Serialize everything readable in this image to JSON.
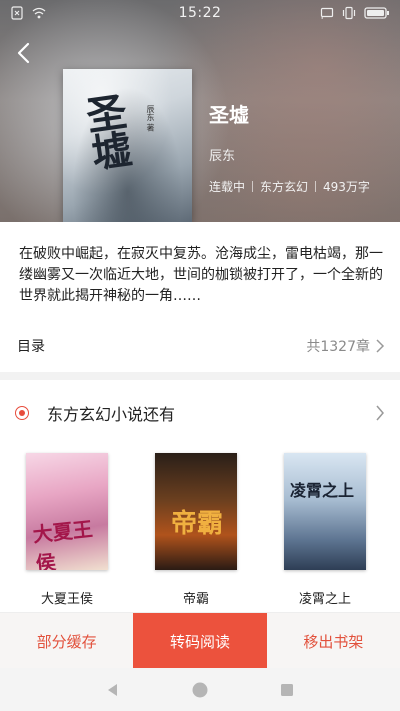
{
  "status_bar": {
    "time": "15:22",
    "left_icons": [
      "sim-icon",
      "wifi-icon"
    ],
    "right_icons": [
      "cast-icon",
      "vibrate-icon",
      "battery-icon"
    ]
  },
  "book": {
    "title": "圣墟",
    "author": "辰东",
    "status": "连载中",
    "genre": "东方玄幻",
    "word_count": "493万字",
    "cover_title_text": "圣墟",
    "cover_author_text": "辰东 著",
    "description": "在破败中崛起，在寂灭中复苏。沧海成尘，雷电枯竭，那一缕幽雾又一次临近大地，世间的枷锁被打开了，一个全新的世界就此揭开神秘的一角……"
  },
  "toc": {
    "label": "目录",
    "count": "共1327章"
  },
  "recommend": {
    "title": "东方玄幻小说还有",
    "books": [
      {
        "name": "大夏王侯",
        "cover_text": "大夏王侯"
      },
      {
        "name": "帝霸",
        "cover_text": "帝霸"
      },
      {
        "name": "凌霄之上",
        "cover_text": "凌霄之上"
      }
    ]
  },
  "actions": {
    "cache": "部分缓存",
    "read": "转码阅读",
    "remove": "移出书架"
  },
  "colors": {
    "accent": "#ec523d",
    "accent_text": "#e2513c"
  }
}
